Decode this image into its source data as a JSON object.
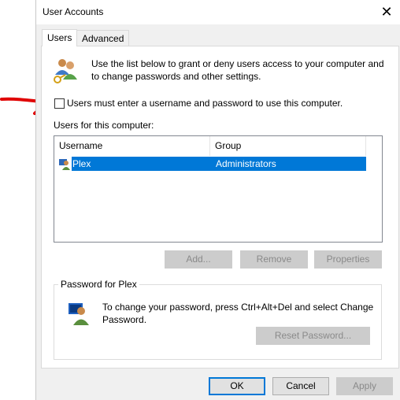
{
  "window": {
    "title": "User Accounts",
    "close_glyph": "✕"
  },
  "tabs": [
    {
      "label": "Users"
    },
    {
      "label": "Advanced"
    }
  ],
  "intro": {
    "text_line1": "Use the list below to grant or deny users access to your computer and",
    "text_line2": "to change passwords and other settings."
  },
  "checkbox": {
    "label": "Users must enter a username and password to use this computer.",
    "checked": false
  },
  "users_section": {
    "label": "Users for this computer:"
  },
  "table": {
    "columns": [
      "Username",
      "Group"
    ],
    "rows": [
      {
        "username": "Plex",
        "group": "Administrators",
        "selected": true
      }
    ]
  },
  "user_buttons": {
    "add": "Add...",
    "remove": "Remove",
    "properties": "Properties"
  },
  "password_group": {
    "title": "Password for Plex",
    "text_line1": "To change your password, press Ctrl+Alt+Del and select Change",
    "text_line2": "Password.",
    "reset_button": "Reset Password..."
  },
  "footer": {
    "ok": "OK",
    "cancel": "Cancel",
    "apply": "Apply"
  },
  "colors": {
    "selection": "#0078d7",
    "annotation_arrow": "#e00000",
    "dialog_bg": "#f0f0f0"
  }
}
